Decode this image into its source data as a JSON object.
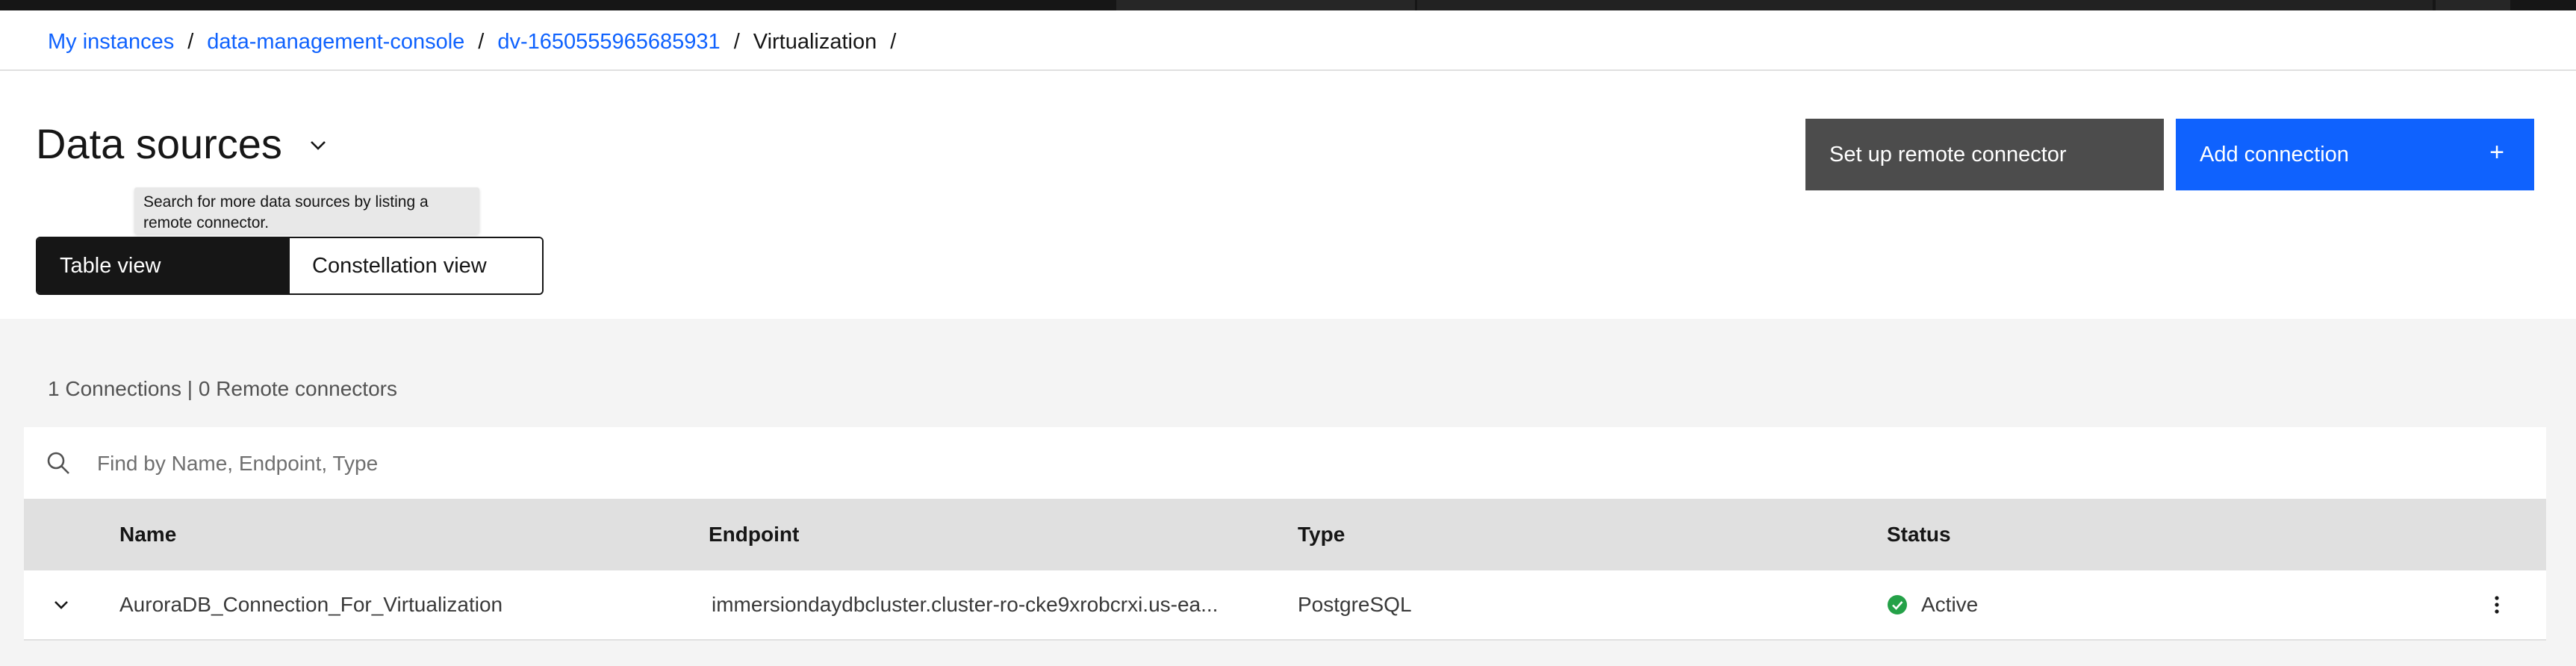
{
  "breadcrumb": {
    "items": [
      "My instances",
      "data-management-console",
      "dv-1650555965685931"
    ],
    "current": "Virtualization",
    "separator": "/"
  },
  "page": {
    "title": "Data sources"
  },
  "actions": {
    "remote_connector_label": "Set up remote connector",
    "add_connection_label": "Add connection"
  },
  "tooltip": {
    "text": "Search for more data sources by listing a remote connector."
  },
  "view_switcher": {
    "table_view": "Table view",
    "constellation_view": "Constellation view",
    "selected": "Table view"
  },
  "summary": {
    "connections": "1 Connections |",
    "remote_connectors": "0 Remote connectors"
  },
  "search": {
    "placeholder": "Find by Name, Endpoint, Type",
    "value": ""
  },
  "table": {
    "columns": [
      "Name",
      "Endpoint",
      "Type",
      "Status"
    ],
    "rows": [
      {
        "name": "AuroraDB_Connection_For_Virtualization",
        "endpoint": "immersiondaydbcluster.cluster-ro-cke9xrobcrxi.us-ea...",
        "type": "PostgreSQL",
        "status": "Active"
      }
    ]
  },
  "colors": {
    "primary": "#0f62fe",
    "secondary_button": "#4c4c4c",
    "status_active": "#24a148",
    "header_bg": "#e0e0e0",
    "content_bg": "#f4f4f4"
  },
  "icons": {
    "title_menu": "chevron-down-icon",
    "add": "plus-icon",
    "search": "search-icon",
    "row_expand": "chevron-down-icon",
    "status": "checkmark-filled-icon",
    "row_menu": "overflow-menu-vertical-icon"
  }
}
